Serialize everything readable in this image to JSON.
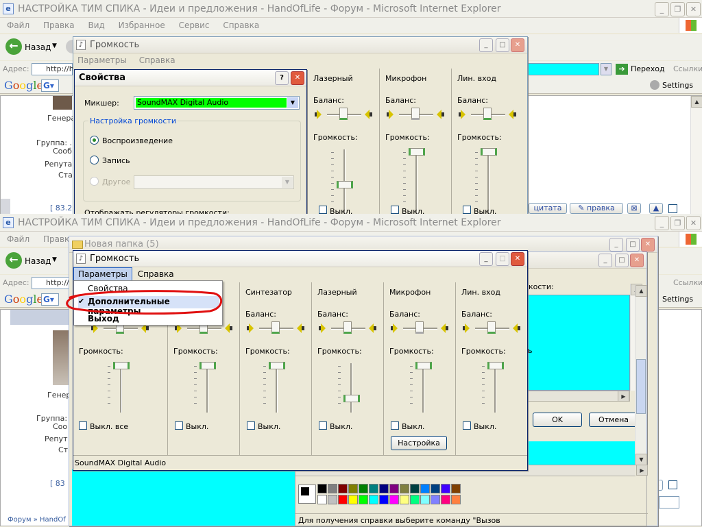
{
  "ie_top": {
    "title": "НАСТРОЙКА ТИМ СПИКА - Идеи и предложения - HandOfLife - Форум - Microsoft Internet Explorer",
    "menu": [
      "Файл",
      "Правка",
      "Вид",
      "Избранное",
      "Сервис",
      "Справка"
    ],
    "back_label": "Назад",
    "address_label": "Адрес:",
    "address_value": "http://h",
    "go_label": "Переход",
    "links_label": "Ссылки",
    "google": "Google",
    "settings_label": "Settings",
    "profile": {
      "gen": "Генера",
      "group": "Группа: .",
      "posts": "Сооб",
      "rep": "Репута",
      "status": "Ста"
    },
    "post_link": "[ 83.2",
    "quote_btn": "цитата",
    "edit_btn": "правка"
  },
  "ie_bottom": {
    "title": "НАСТРОЙКА ТИМ СПИКА - Идеи и предложения - HandOfLife - Форум - Microsoft Internet Explorer",
    "menu": [
      "Файл",
      "Правка"
    ],
    "back_label": "Назад",
    "address_label": "Адрес:",
    "address_value": "http://",
    "links_label": "Ссылки",
    "google": "Google",
    "settings_label": "Settings",
    "profile": {
      "gen": "Генер",
      "group": "Группа:",
      "posts": "Соо",
      "rep": "Репут",
      "status": "Ст"
    },
    "post_link": "[ 83",
    "footer_nav": "Форум » HandOf"
  },
  "volume_top": {
    "title": "Громкость",
    "menu": [
      "Параметры",
      "Справка"
    ],
    "columns": [
      {
        "name": "Лазерный",
        "balance": "Баланс:",
        "volume": "Громкость:",
        "mute": "Выкл."
      },
      {
        "name": "Микрофон",
        "balance": "Баланс:",
        "volume": "Громкость:",
        "mute": "Выкл."
      },
      {
        "name": "Лин. вход",
        "balance": "Баланс:",
        "volume": "Громкость:",
        "mute": "Выкл."
      }
    ]
  },
  "props_dialog": {
    "title": "Свойства",
    "mixer_label": "Микшер:",
    "mixer_value": "SoundMAX Digital Audio",
    "group_title": "Настройка громкости",
    "radio_play": "Воспроизведение",
    "radio_rec": "Запись",
    "radio_other": "Другое",
    "show_label": "Отображать регуляторы громкости:"
  },
  "folder_window": {
    "title": "Новая папка (5)"
  },
  "volume_main": {
    "title": "Громкость",
    "menu": [
      "Параметры",
      "Справка"
    ],
    "dropdown": [
      "Свойства",
      "Дополнительные параметры",
      "Выход"
    ],
    "columns": [
      {
        "name": "",
        "balance": "",
        "volume": "Громкость:",
        "mute": "Выкл. все"
      },
      {
        "name": "",
        "balance": "",
        "volume": "Громкость:",
        "mute": "Выкл."
      },
      {
        "name": "Синтезатор",
        "balance": "Баланс:",
        "volume": "Громкость:",
        "mute": "Выкл."
      },
      {
        "name": "Лазерный",
        "balance": "Баланс:",
        "volume": "Громкость:",
        "mute": "Выкл."
      },
      {
        "name": "Микрофон",
        "balance": "Баланс:",
        "volume": "Громкость:",
        "mute": "Выкл.",
        "button": "Настройка"
      },
      {
        "name": "Лин. вход",
        "balance": "Баланс:",
        "volume": "Громкость:",
        "mute": "Выкл."
      }
    ],
    "status": "SoundMAX Digital Audio"
  },
  "right_dialog": {
    "label_fragment": "кости:",
    "text_fragment": "ь",
    "ok": "OK",
    "cancel": "Отмена"
  },
  "paint": {
    "status": "Для получения справки выберите команду \"Вызов"
  },
  "colors": {
    "cyan": "#00ffff",
    "green_combo": "#00ff00",
    "annotation_red": "#e01010",
    "slider_green": "#4ea54a"
  }
}
